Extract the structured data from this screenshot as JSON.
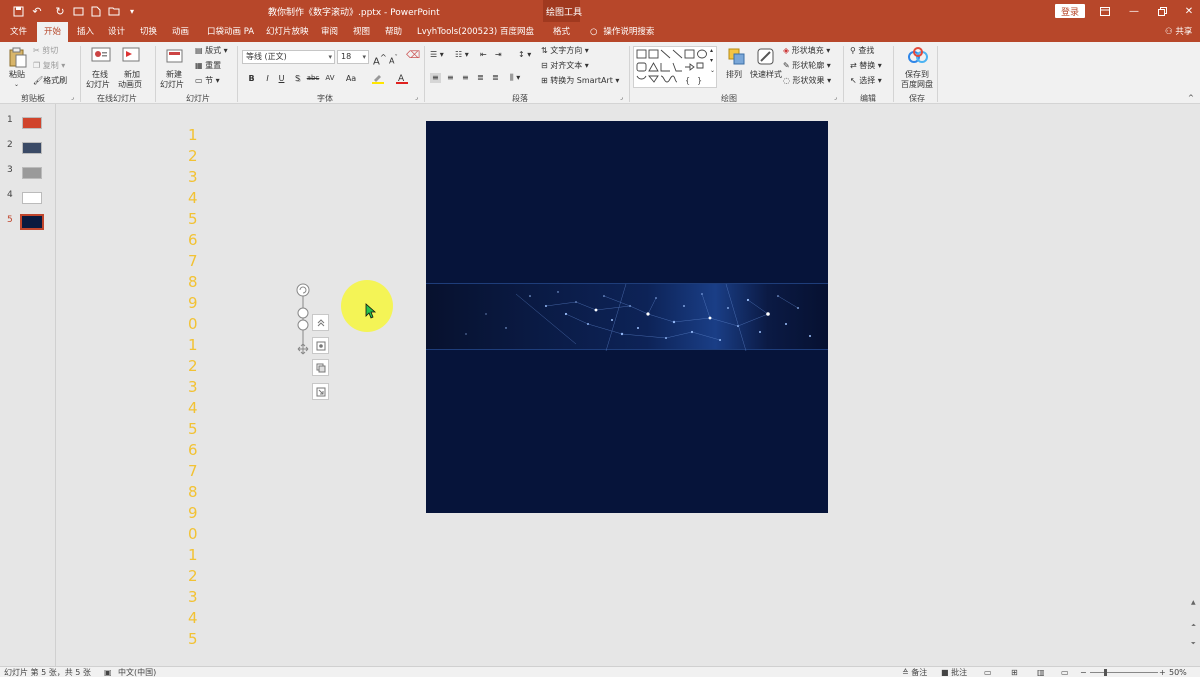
{
  "titlebar": {
    "document_title": "教你制作《数字滚动》.pptx  -  PowerPoint",
    "context_title": "绘图工具",
    "login_label": "登录",
    "accent_color": "#b7472a"
  },
  "tabs": [
    {
      "label": "文件"
    },
    {
      "label": "开始"
    },
    {
      "label": "插入"
    },
    {
      "label": "设计"
    },
    {
      "label": "切换"
    },
    {
      "label": "动画"
    },
    {
      "label": "口袋动画 PA"
    },
    {
      "label": "幻灯片放映"
    },
    {
      "label": "审阅"
    },
    {
      "label": "视图"
    },
    {
      "label": "帮助"
    },
    {
      "label": "LvyhTools(200523)"
    },
    {
      "label": "百度网盘"
    },
    {
      "label": "格式"
    }
  ],
  "tell_me": "操作说明搜索",
  "share": "共享",
  "ribbon": {
    "clipboard": {
      "paste": "粘贴",
      "cut": "剪切",
      "copy": "复制",
      "format_painter": "格式刷",
      "label": "剪贴板"
    },
    "online_slides": {
      "btn1_line1": "在线",
      "btn1_line2": "幻灯片",
      "btn2_line1": "新加",
      "btn2_line2": "动画页",
      "label": "在线幻灯片"
    },
    "slides": {
      "new_line1": "新建",
      "new_line2": "幻灯片",
      "layout": "版式",
      "reset": "重置",
      "section": "节",
      "label": "幻灯片"
    },
    "font": {
      "font_name": "等线 (正文)",
      "font_size": "18",
      "label": "字体",
      "bold": "B",
      "italic": "I",
      "underline": "U",
      "shadow": "S",
      "strike": "abc",
      "spacing": "AV",
      "case": "Aa",
      "grow": "A",
      "shrink": "A"
    },
    "paragraph": {
      "text_direction": "文字方向",
      "align_text": "对齐文本",
      "smartart": "转换为 SmartArt",
      "label": "段落"
    },
    "drawing": {
      "arrange": "排列",
      "quick_styles": "快速样式",
      "shape_fill": "形状填充",
      "shape_outline": "形状轮廓",
      "shape_effects": "形状效果",
      "label": "绘图"
    },
    "editing": {
      "find": "查找",
      "replace": "替换",
      "select": "选择",
      "label": "编辑"
    },
    "save": {
      "line1": "保存到",
      "line2": "百度网盘",
      "label": "保存"
    }
  },
  "thumbnails": [
    {
      "num": "1",
      "color": "#d0442c"
    },
    {
      "num": "2",
      "color": "#3a4a66"
    },
    {
      "num": "3",
      "color": "#9a9a9a"
    },
    {
      "num": "4",
      "color": "#ffffff"
    },
    {
      "num": "5",
      "color": "#0a1a3f",
      "active": true
    }
  ],
  "digit_column": [
    "1",
    "2",
    "3",
    "4",
    "5",
    "6",
    "7",
    "8",
    "9",
    "0",
    "1",
    "2",
    "3",
    "4",
    "5",
    "6",
    "7",
    "8",
    "9",
    "0",
    "1",
    "2",
    "3",
    "4",
    "5"
  ],
  "statusbar": {
    "slide_info": "幻灯片 第 5 张，共 5 张",
    "language": "中文(中国)",
    "notes": "备注",
    "comments": "批注",
    "zoom": "50%"
  }
}
